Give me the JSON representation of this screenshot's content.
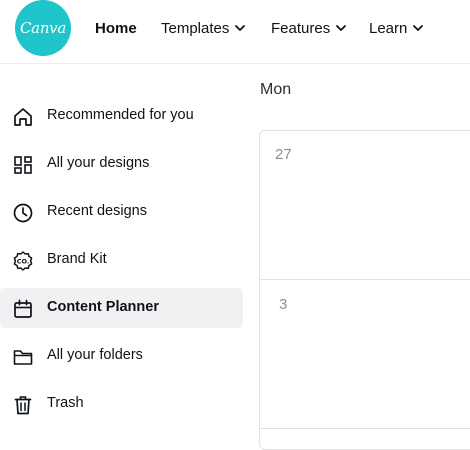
{
  "header": {
    "logo_text": "Canva",
    "nav": [
      {
        "label": "Home"
      },
      {
        "label": "Templates"
      },
      {
        "label": "Features"
      },
      {
        "label": "Learn"
      }
    ]
  },
  "sidebar": {
    "items": [
      {
        "label": "Recommended for you",
        "icon": "home-icon"
      },
      {
        "label": "All your designs",
        "icon": "grid-icon"
      },
      {
        "label": "Recent designs",
        "icon": "clock-icon"
      },
      {
        "label": "Brand Kit",
        "icon": "brand-kit-icon"
      },
      {
        "label": "Content Planner",
        "icon": "calendar-icon",
        "active": true
      },
      {
        "label": "All your folders",
        "icon": "folder-icon"
      },
      {
        "label": "Trash",
        "icon": "trash-icon"
      }
    ]
  },
  "calendar": {
    "day_label": "Mon",
    "dates": [
      "27",
      "3"
    ]
  },
  "colors": {
    "brand": "#20c4cb",
    "active_bg": "#f1f1f3"
  }
}
